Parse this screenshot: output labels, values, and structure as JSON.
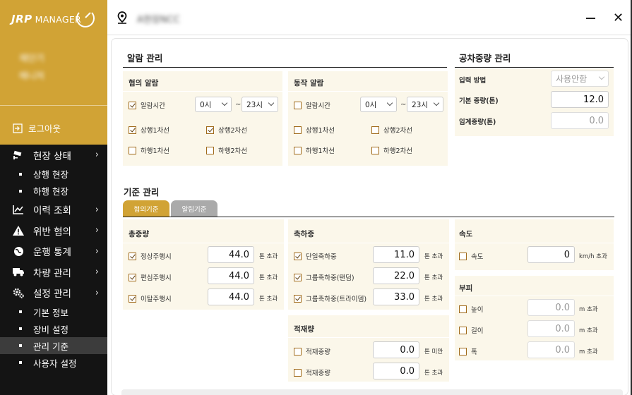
{
  "app": {
    "logo_jrp": "JRP",
    "logo_manager": "MANAGER"
  },
  "sidebar": {
    "user_name": "재단기",
    "user_role": "매니저",
    "logout": "로그아웃",
    "menu": [
      {
        "label": "현장 상태",
        "icon": "cctv-icon"
      },
      {
        "label": "이력 조회",
        "icon": "chart-icon"
      },
      {
        "label": "위반 혐의",
        "icon": "warning-icon"
      },
      {
        "label": "운행 통계",
        "icon": "globe-icon"
      },
      {
        "label": "차량 관리",
        "icon": "truck-icon"
      },
      {
        "label": "설정 관리",
        "icon": "gear-icon"
      }
    ],
    "sub_status": [
      "상행 현장",
      "하행 현장"
    ],
    "sub_settings": [
      "기본 정보",
      "장비 설정",
      "관리 기준",
      "사용자 설정"
    ],
    "active_sub": "관리 기준"
  },
  "topbar": {
    "site_name": "A현장NCC"
  },
  "alarm": {
    "title": "알람 관리",
    "suspect": {
      "title": "혐의 알람",
      "time_label": "알람시간",
      "time_checked": true,
      "from": "0시",
      "to": "23시",
      "tilde": "~",
      "lanes": [
        {
          "label": "상행1차선",
          "checked": true
        },
        {
          "label": "상행2차선",
          "checked": true
        },
        {
          "label": "하행1차선",
          "checked": false
        },
        {
          "label": "하행2차선",
          "checked": false
        }
      ]
    },
    "operation": {
      "title": "동작 알람",
      "time_label": "알람시간",
      "time_checked": false,
      "from": "0시",
      "to": "23시",
      "tilde": "~",
      "lanes": [
        {
          "label": "상행1차선",
          "checked": false
        },
        {
          "label": "상행2차선",
          "checked": false
        },
        {
          "label": "하행1차선",
          "checked": false
        },
        {
          "label": "하행2차선",
          "checked": false
        }
      ]
    }
  },
  "empty_weight": {
    "title": "공차중량 관리",
    "input_method_label": "입력 방법",
    "input_method_value": "사용안함",
    "base_label": "기본 중량(톤)",
    "base_value": "12.0",
    "threshold_label": "임계중량(톤)",
    "threshold_value": "0.0"
  },
  "criteria": {
    "title": "기준 관리",
    "tabs": [
      "혐의기준",
      "알림기준"
    ],
    "total_weight": {
      "title": "총중량",
      "rows": [
        {
          "label": "정상주행시",
          "checked": true,
          "value": "44.0",
          "unit": "톤 초과"
        },
        {
          "label": "편심주행시",
          "checked": true,
          "value": "44.0",
          "unit": "톤 초과"
        },
        {
          "label": "이탈주행시",
          "checked": true,
          "value": "44.0",
          "unit": "톤 초과"
        }
      ]
    },
    "axle_weight": {
      "title": "축하중",
      "rows": [
        {
          "label": "단일축하중",
          "checked": true,
          "value": "11.0",
          "unit": "톤 초과"
        },
        {
          "label": "그룹축하중(탠덤)",
          "checked": true,
          "value": "22.0",
          "unit": "톤 초과"
        },
        {
          "label": "그룹축하중(트라이뎀)",
          "checked": true,
          "value": "33.0",
          "unit": "톤 초과"
        }
      ]
    },
    "load": {
      "title": "적재량",
      "rows": [
        {
          "label": "적재중량",
          "checked": false,
          "value": "0.0",
          "unit": "톤 미만"
        },
        {
          "label": "적재중량",
          "checked": false,
          "value": "0.0",
          "unit": "톤 초과"
        }
      ]
    },
    "speed": {
      "title": "속도",
      "rows": [
        {
          "label": "속도",
          "checked": false,
          "value": "0",
          "unit": "km/h 초과"
        }
      ]
    },
    "volume": {
      "title": "부피",
      "rows": [
        {
          "label": "높이",
          "checked": false,
          "value": "0.0",
          "unit": "m 초과"
        },
        {
          "label": "길이",
          "checked": false,
          "value": "0.0",
          "unit": "m 초과"
        },
        {
          "label": "폭",
          "checked": false,
          "value": "0.0",
          "unit": "m 초과"
        }
      ]
    }
  },
  "colors": {
    "accent": "#d1a335",
    "sidebar_bg": "#141414",
    "box_bg": "#fbf7ea"
  }
}
